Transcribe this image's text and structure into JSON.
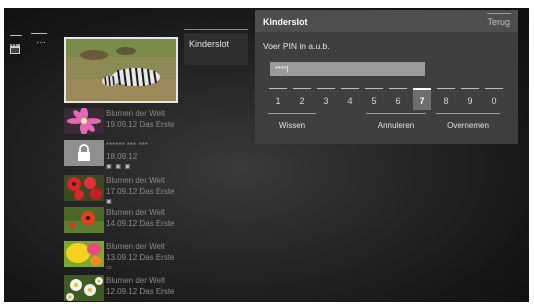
{
  "sidebar": {
    "dots": "···"
  },
  "featured": {
    "icon": "zebra-photo"
  },
  "recordings": [
    {
      "title": "Blumen der Welt",
      "date": "19.09.12 Das Erste",
      "icons": "",
      "thumb": "pink-flower"
    },
    {
      "title": "****** *** ***",
      "date": "18.09.12",
      "icons": "▣ ▣ ▣",
      "thumb": "lock"
    },
    {
      "title": "Blumen der Welt",
      "date": "17.09.12 Das Erste",
      "icons": "▣",
      "thumb": "red-flowers"
    },
    {
      "title": "Blumen der Welt",
      "date": "14.09.12 Das Erste",
      "icons": "",
      "thumb": "red-poppy"
    },
    {
      "title": "Blumen der Welt",
      "date": "13.09.12 Das Erste",
      "icons": "▭",
      "thumb": "yellow-flower"
    },
    {
      "title": "Blumen der Welt",
      "date": "12.09.12 Das Erste",
      "icons": "",
      "thumb": "daisies"
    }
  ],
  "menu_tile": {
    "label": "Kinderslot"
  },
  "dialog": {
    "title": "Kinderslot",
    "back_label": "Terug",
    "prompt": "Voer PIN in a.u.b.",
    "pin_value": "****|",
    "keys": [
      "1",
      "2",
      "3",
      "4",
      "5",
      "6",
      "7",
      "8",
      "9",
      "0"
    ],
    "selected_key": "7",
    "actions": {
      "forgot": "Wissen",
      "cancel": "Annuleren",
      "confirm": "Overnemen"
    }
  }
}
